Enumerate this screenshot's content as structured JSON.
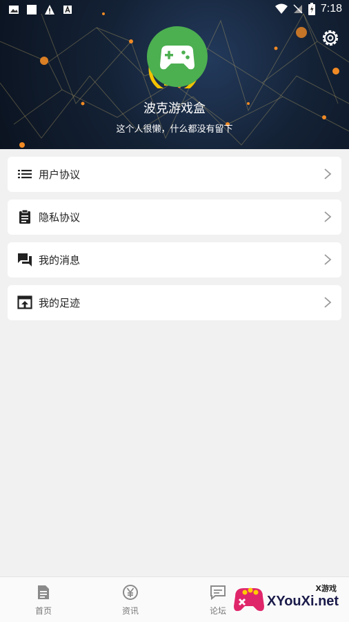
{
  "status_bar": {
    "time": "7:18"
  },
  "profile": {
    "name": "波克游戏盒",
    "bio": "这个人很懒，什么都没有留下"
  },
  "menu": [
    {
      "label": "用户协议",
      "icon": "list-icon"
    },
    {
      "label": "隐私协议",
      "icon": "clipboard-icon"
    },
    {
      "label": "我的消息",
      "icon": "chat-icon"
    },
    {
      "label": "我的足迹",
      "icon": "upload-box-icon"
    }
  ],
  "tabs": [
    {
      "label": "首页",
      "icon": "document-icon"
    },
    {
      "label": "资讯",
      "icon": "yen-circle-icon"
    },
    {
      "label": "论坛",
      "icon": "chat-bubble-icon"
    }
  ],
  "watermark": {
    "top": "X游戏",
    "main": "XYouXi.net"
  },
  "colors": {
    "avatar_green": "#4caf50",
    "ring_yellow": "#f2c200",
    "header_dark": "#142236",
    "node_orange": "#f08a24"
  }
}
